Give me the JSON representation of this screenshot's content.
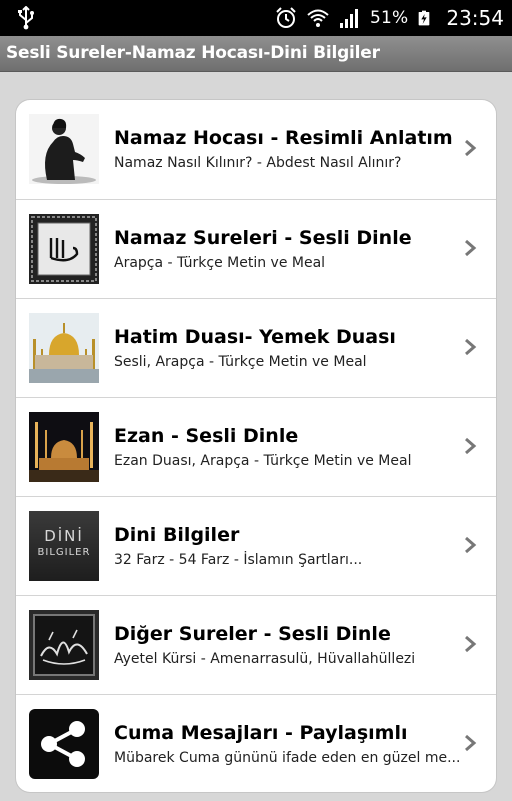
{
  "status_bar": {
    "battery_percent": "51%",
    "time": "23:54"
  },
  "app_bar": {
    "title": "Sesli Sureler-Namaz Hocası-Dini Bilgiler"
  },
  "menu": {
    "items": [
      {
        "title": "Namaz Hocası - Resimli Anlatım",
        "subtitle": "Namaz Nasıl Kılınır? - Abdest Nasıl Alınır?"
      },
      {
        "title": "Namaz Sureleri - Sesli Dinle",
        "subtitle": "Arapça - Türkçe Metin ve Meal"
      },
      {
        "title": "Hatim Duası- Yemek Duası",
        "subtitle": "Sesli, Arapça - Türkçe Metin ve Meal"
      },
      {
        "title": "Ezan - Sesli Dinle",
        "subtitle": "Ezan Duası, Arapça - Türkçe Metin ve Meal"
      },
      {
        "title": "Dini Bilgiler",
        "subtitle": "32 Farz - 54 Farz - İslamın Şartları..."
      },
      {
        "title": "Diğer Sureler - Sesli Dinle",
        "subtitle": "Ayetel Kürsi - Amenarrasulü, Hüvallahüllezi"
      },
      {
        "title": "Cuma Mesajları - Paylaşımlı",
        "subtitle": "Mübarek Cuma gününü ifade eden en güzel me..."
      }
    ],
    "thumbnail_labels": {
      "dini_bilgiler_line1": "DİNİ",
      "dini_bilgiler_line2": "BILGILER"
    }
  }
}
